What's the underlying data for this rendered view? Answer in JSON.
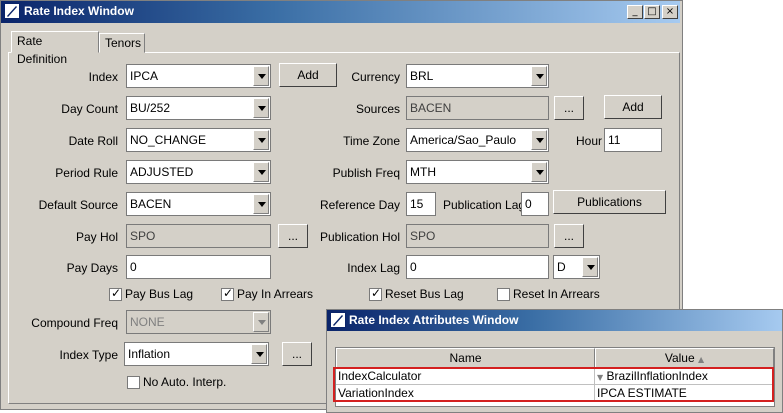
{
  "main_window": {
    "title": "Rate Index Window",
    "controls": {
      "minimize": "_",
      "maximize": "□",
      "close": "×"
    },
    "tabs": [
      {
        "label": "Rate Definition"
      },
      {
        "label": "Tenors"
      }
    ]
  },
  "form": {
    "index": {
      "label": "Index",
      "value": "IPCA",
      "add_label": "Add"
    },
    "day_count": {
      "label": "Day Count",
      "value": "BU/252"
    },
    "date_roll": {
      "label": "Date Roll",
      "value": "NO_CHANGE"
    },
    "period_rule": {
      "label": "Period Rule",
      "value": "ADJUSTED"
    },
    "default_source": {
      "label": "Default Source",
      "value": "BACEN"
    },
    "pay_hol": {
      "label": "Pay Hol",
      "value": "SPO",
      "browse_label": "..."
    },
    "pay_days": {
      "label": "Pay Days",
      "value": "0"
    },
    "pay_bus_lag": {
      "label": "Pay Bus Lag",
      "checked": true
    },
    "pay_in_arrears": {
      "label": "Pay In Arrears",
      "checked": true
    },
    "compound_freq": {
      "label": "Compound Freq",
      "value": "NONE"
    },
    "index_type": {
      "label": "Index Type",
      "value": "Inflation",
      "browse_label": "..."
    },
    "no_auto_interp": {
      "label": "No Auto. Interp.",
      "checked": false
    },
    "currency": {
      "label": "Currency",
      "value": "BRL"
    },
    "sources": {
      "label": "Sources",
      "value": "BACEN",
      "browse_label": "...",
      "add_label": "Add"
    },
    "time_zone": {
      "label": "Time Zone",
      "value": "America/Sao_Paulo"
    },
    "hour": {
      "label": "Hour",
      "value": "11"
    },
    "publish_freq": {
      "label": "Publish Freq",
      "value": "MTH"
    },
    "reference_day": {
      "label": "Reference Day",
      "value": "15"
    },
    "publication_lag": {
      "label": "Publication Lag",
      "value": "0"
    },
    "publications_button": "Publications",
    "publication_hol": {
      "label": "Publication Hol",
      "value": "SPO",
      "browse_label": "..."
    },
    "index_lag": {
      "label": "Index Lag",
      "value": "0",
      "unit": "D"
    },
    "reset_bus_lag": {
      "label": "Reset Bus Lag",
      "checked": true
    },
    "reset_in_arrears": {
      "label": "Reset In Arrears",
      "checked": false
    }
  },
  "attributes_window": {
    "title": "Rate Index Attributes Window",
    "columns": {
      "name": "Name",
      "value": "Value"
    },
    "rows": [
      {
        "name": "IndexCalculator",
        "value": "BrazilInflationIndex"
      },
      {
        "name": "VariationIndex",
        "value": "IPCA ESTIMATE"
      }
    ]
  },
  "colors": {
    "titlebar": "#0a246a",
    "window_bg": "#d4d0c8",
    "highlight": "#d42020"
  }
}
